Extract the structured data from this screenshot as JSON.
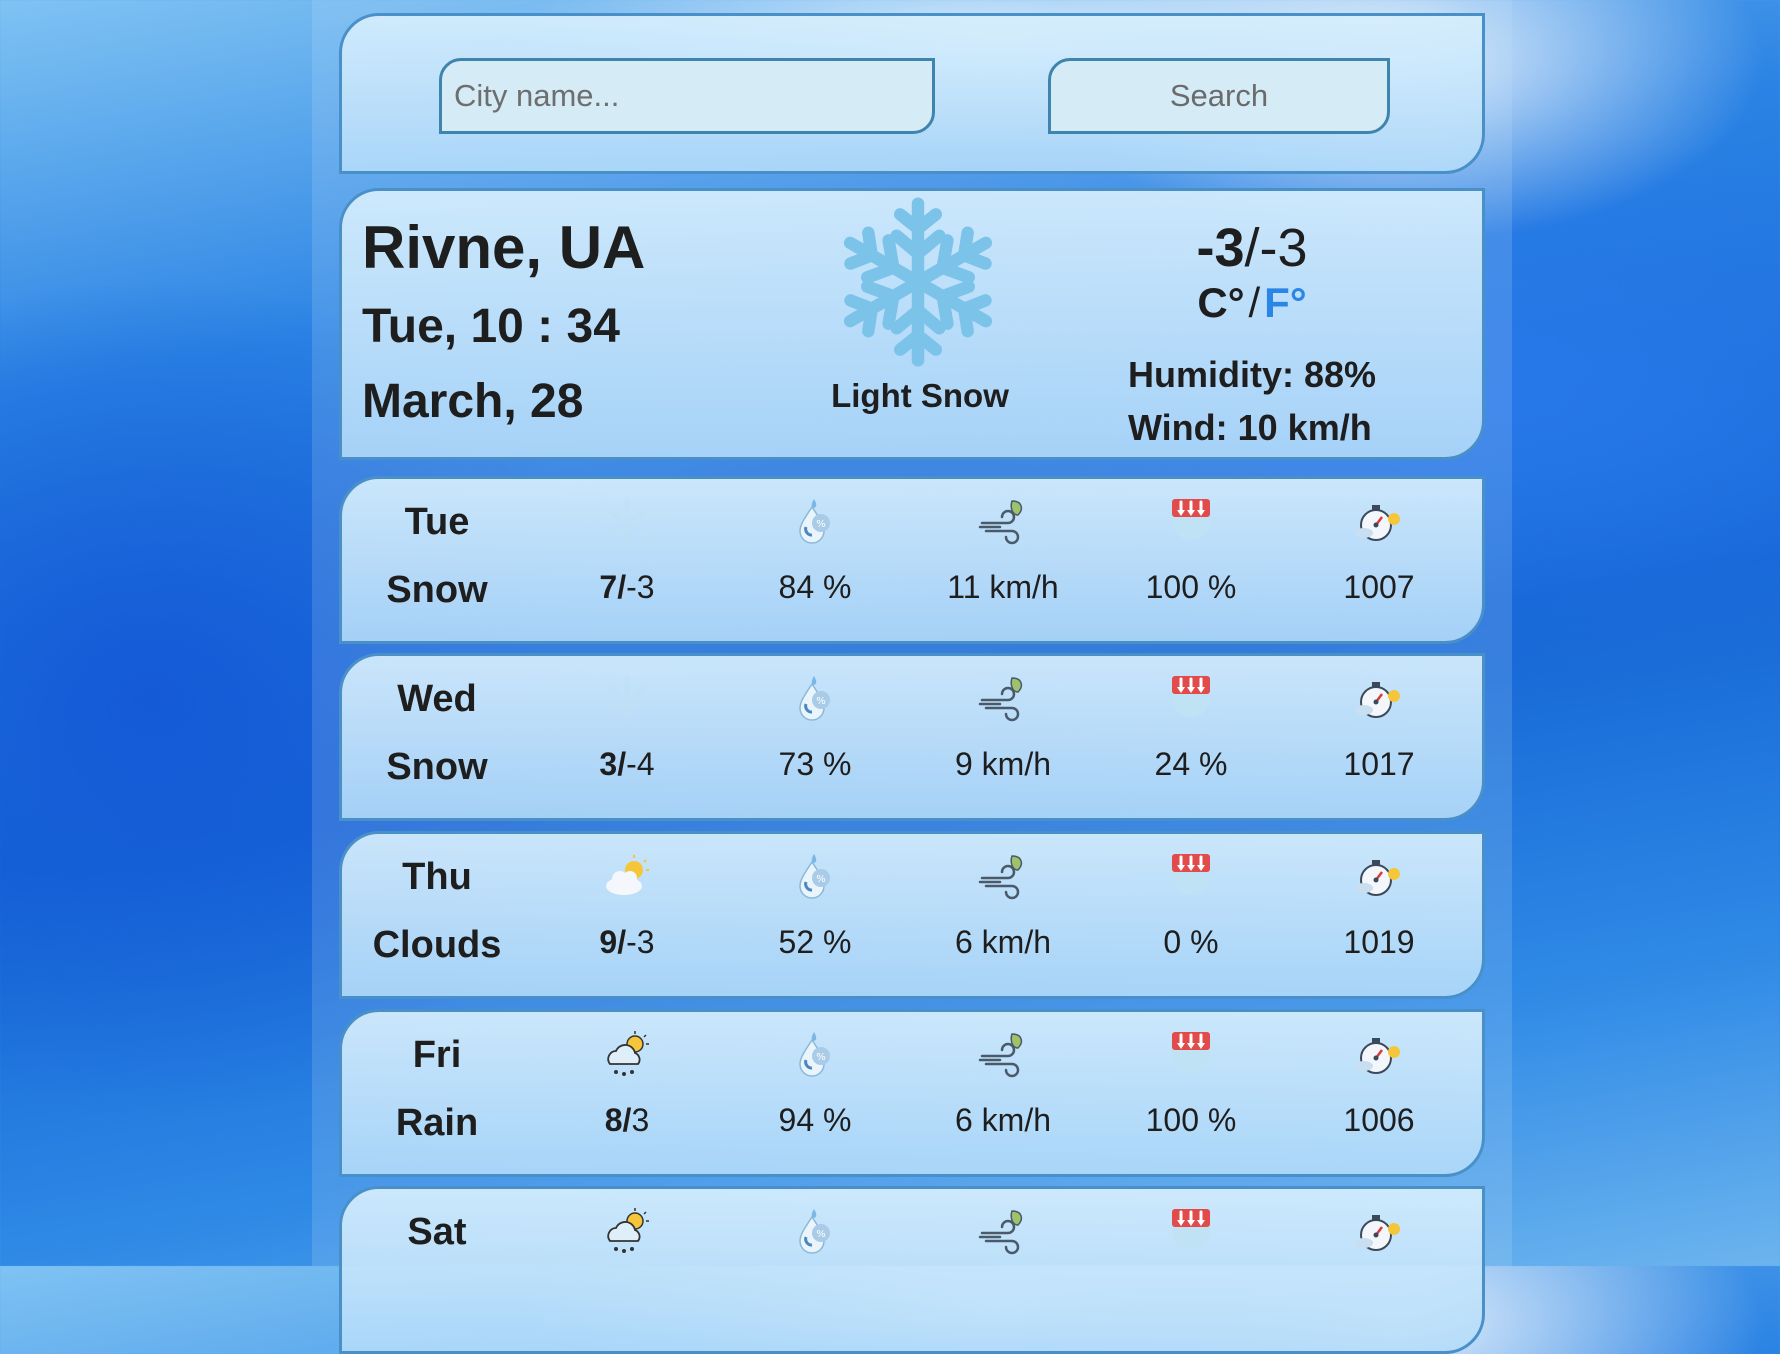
{
  "search": {
    "placeholder": "City name...",
    "button_label": "Search"
  },
  "current": {
    "city": "Rivne, UA",
    "time": "Tue, 10 : 34",
    "date": "March, 28",
    "condition": "Light Snow",
    "temp_high": "-3",
    "temp_sep": "/",
    "temp_low": "-3",
    "unit_c": "C°",
    "unit_slash": "/",
    "unit_f": "F°",
    "humidity": "Humidity: 88%",
    "wind": "Wind: 10 km/h",
    "icon": "snowflake-icon"
  },
  "forecast": [
    {
      "day": "Tue",
      "condition": "Snow",
      "icon": "snowflake-icon",
      "temp_high": "7",
      "temp_low": "-3",
      "humidity": "84 %",
      "wind": "11 km/h",
      "precipitation": "100 %",
      "pressure": "1007"
    },
    {
      "day": "Wed",
      "condition": "Snow",
      "icon": "snowflake-icon",
      "temp_high": "3",
      "temp_low": "-4",
      "humidity": "73 %",
      "wind": "9 km/h",
      "precipitation": "24 %",
      "pressure": "1017"
    },
    {
      "day": "Thu",
      "condition": "Clouds",
      "icon": "sun-cloud-icon",
      "temp_high": "9",
      "temp_low": "-3",
      "humidity": "52 %",
      "wind": "6 km/h",
      "precipitation": "0 %",
      "pressure": "1019"
    },
    {
      "day": "Fri",
      "condition": "Rain",
      "icon": "rain-cloud-icon",
      "temp_high": "8",
      "temp_low": "3",
      "humidity": "94 %",
      "wind": "6 km/h",
      "precipitation": "100 %",
      "pressure": "1006"
    },
    {
      "day": "Sat",
      "condition": "",
      "icon": "rain-cloud-icon",
      "temp_high": "",
      "temp_low": "",
      "humidity": "",
      "wind": "",
      "precipitation": "",
      "pressure": ""
    }
  ],
  "colors": {
    "card_border": "#4a90c8",
    "accent_f": "#2a86e6",
    "text": "#1e1e1e"
  }
}
